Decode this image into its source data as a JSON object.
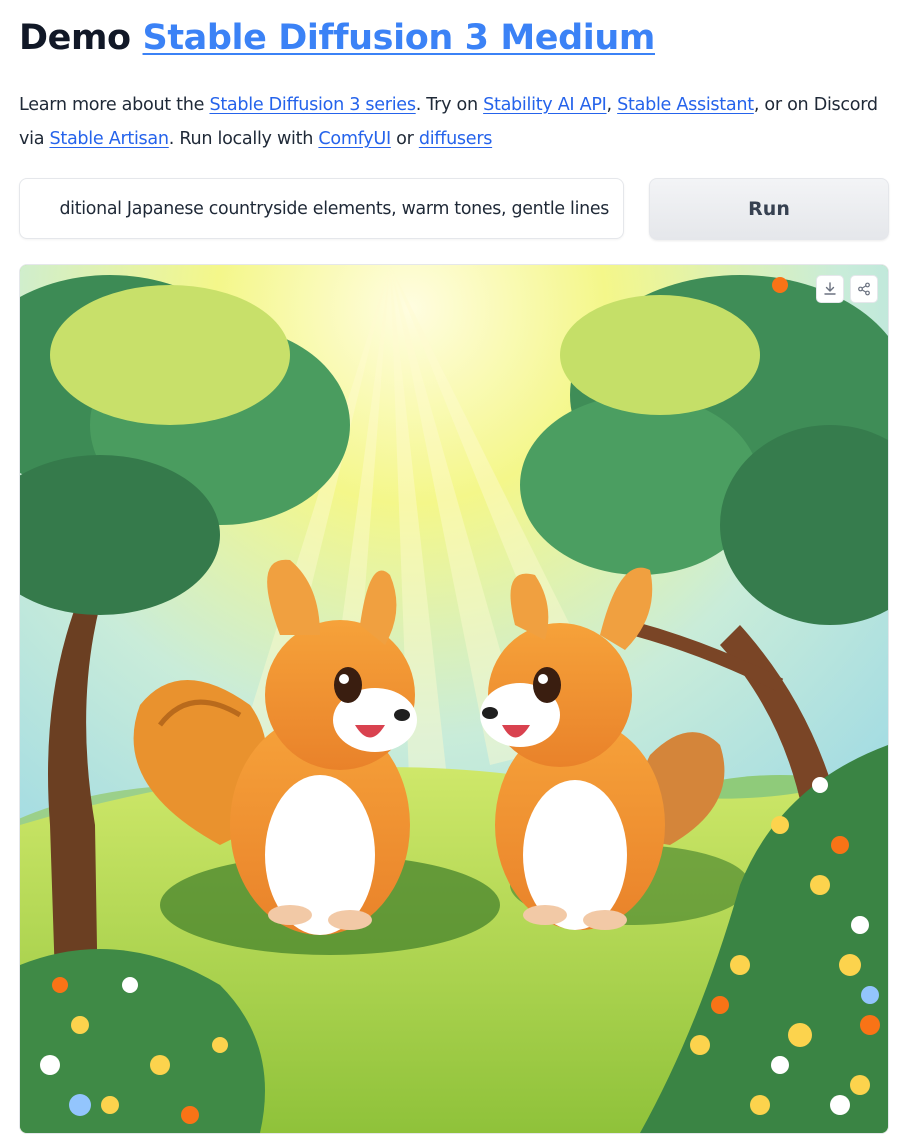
{
  "header": {
    "title_prefix": "Demo",
    "title_link": "Stable Diffusion 3 Medium"
  },
  "description": {
    "text1": "Learn more about the ",
    "link_series": "Stable Diffusion 3 series",
    "text2": ". Try on ",
    "link_api": "Stability AI API",
    "text3": ", ",
    "link_assistant": "Stable Assistant",
    "text4": ", or on Discord via ",
    "link_artisan": "Stable Artisan",
    "text5": ". Run locally with ",
    "link_comfyui": "ComfyUI",
    "text6": " or ",
    "link_diffusers": "diffusers"
  },
  "prompt": {
    "visible_value": "ditional Japanese countryside elements, warm tones, gentle lines"
  },
  "run_button": {
    "label": "Run"
  },
  "result_image": {
    "download_icon": "download-icon",
    "share_icon": "share-icon"
  },
  "colors": {
    "link": "#2563eb",
    "title_link": "#3b82f6",
    "button_bg": "#e5e7eb"
  }
}
